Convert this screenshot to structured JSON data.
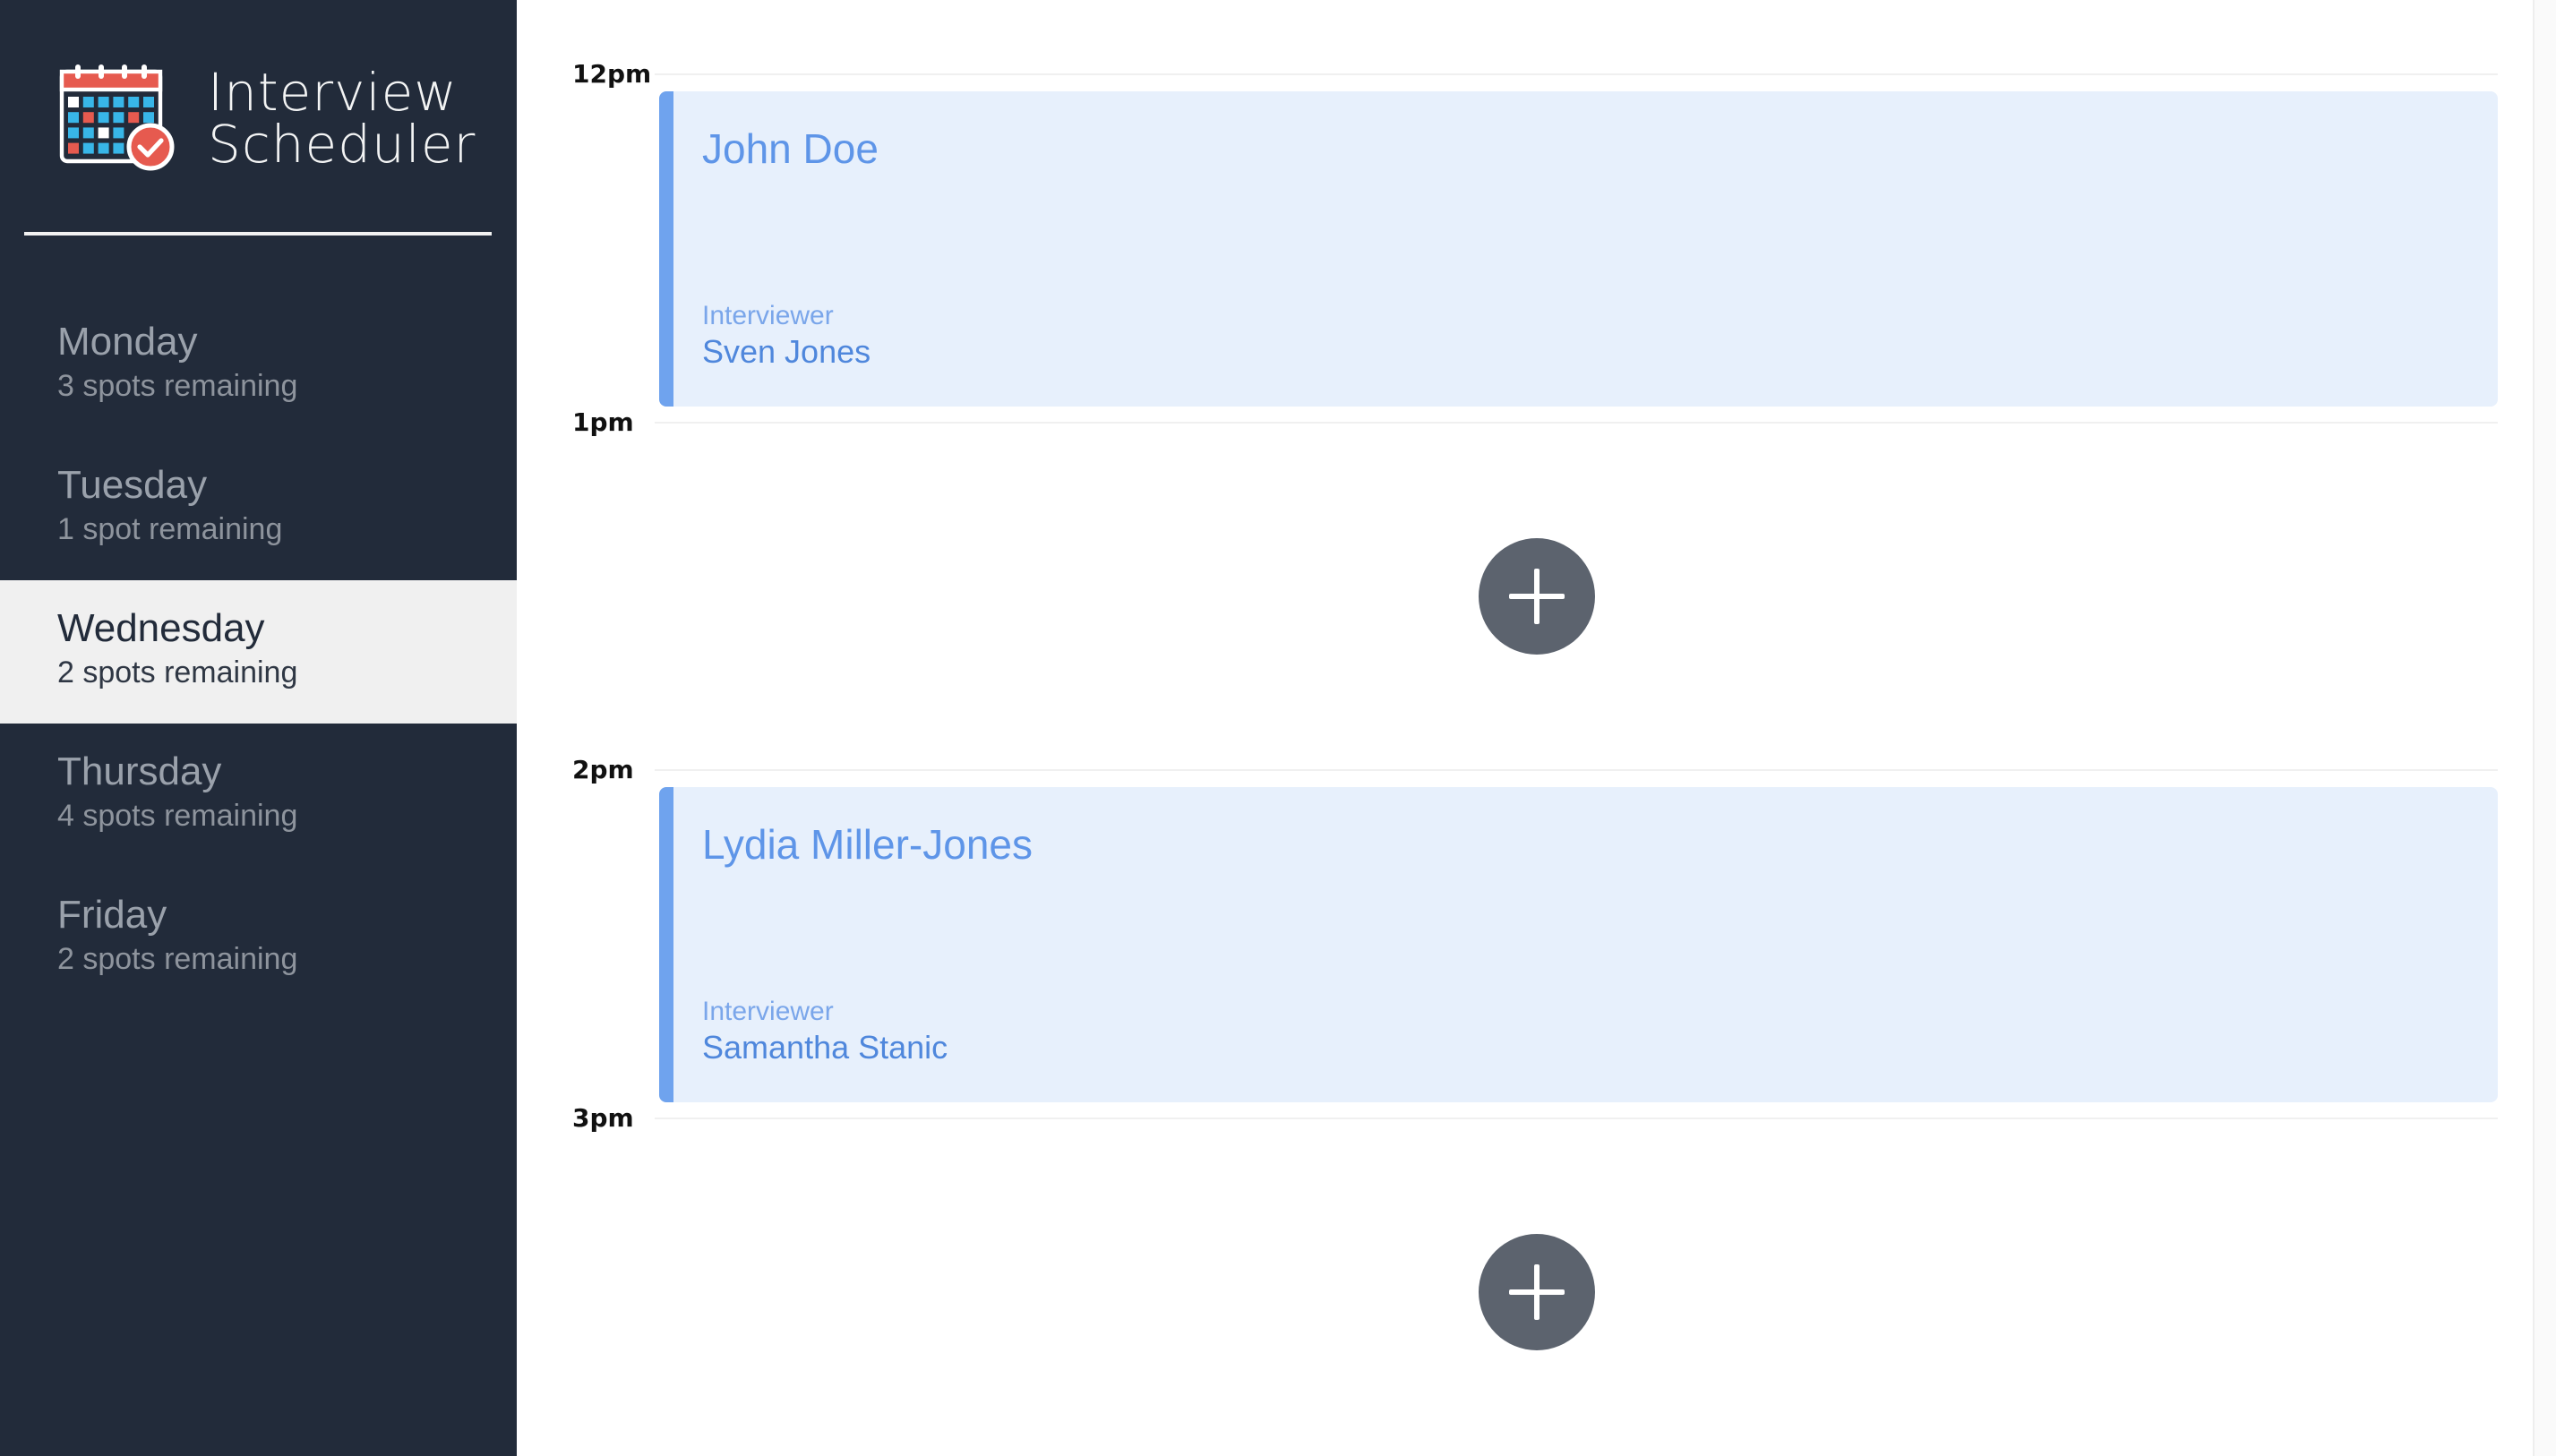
{
  "app": {
    "title_line1": "Interview",
    "title_line2": "Scheduler",
    "logo_icon": "calendar-check-icon"
  },
  "sidebar": {
    "days": [
      {
        "name": "Monday",
        "spots": "3 spots remaining",
        "selected": false
      },
      {
        "name": "Tuesday",
        "spots": "1 spot remaining",
        "selected": false
      },
      {
        "name": "Wednesday",
        "spots": "2 spots remaining",
        "selected": true
      },
      {
        "name": "Thursday",
        "spots": "4 spots remaining",
        "selected": false
      },
      {
        "name": "Friday",
        "spots": "2 spots remaining",
        "selected": false
      }
    ]
  },
  "schedule": {
    "slots": [
      {
        "time": "12pm",
        "booked": true,
        "student": "John Doe",
        "interviewer_label": "Interviewer",
        "interviewer": "Sven Jones"
      },
      {
        "time": "1pm",
        "booked": false,
        "add_icon": "plus-icon"
      },
      {
        "time": "2pm",
        "booked": true,
        "student": "Lydia Miller-Jones",
        "interviewer_label": "Interviewer",
        "interviewer": "Samantha Stanic"
      },
      {
        "time": "3pm",
        "booked": false,
        "add_icon": "plus-icon"
      }
    ]
  },
  "colors": {
    "sidebar_bg": "#222b3a",
    "selected_day_bg": "#f0f0f0",
    "appointment_bg": "#e7f0fc",
    "appointment_accent": "#6fa3ee",
    "add_button_bg": "#5c636e",
    "logo_red": "#e65a4f",
    "logo_blue": "#38b6e8"
  }
}
